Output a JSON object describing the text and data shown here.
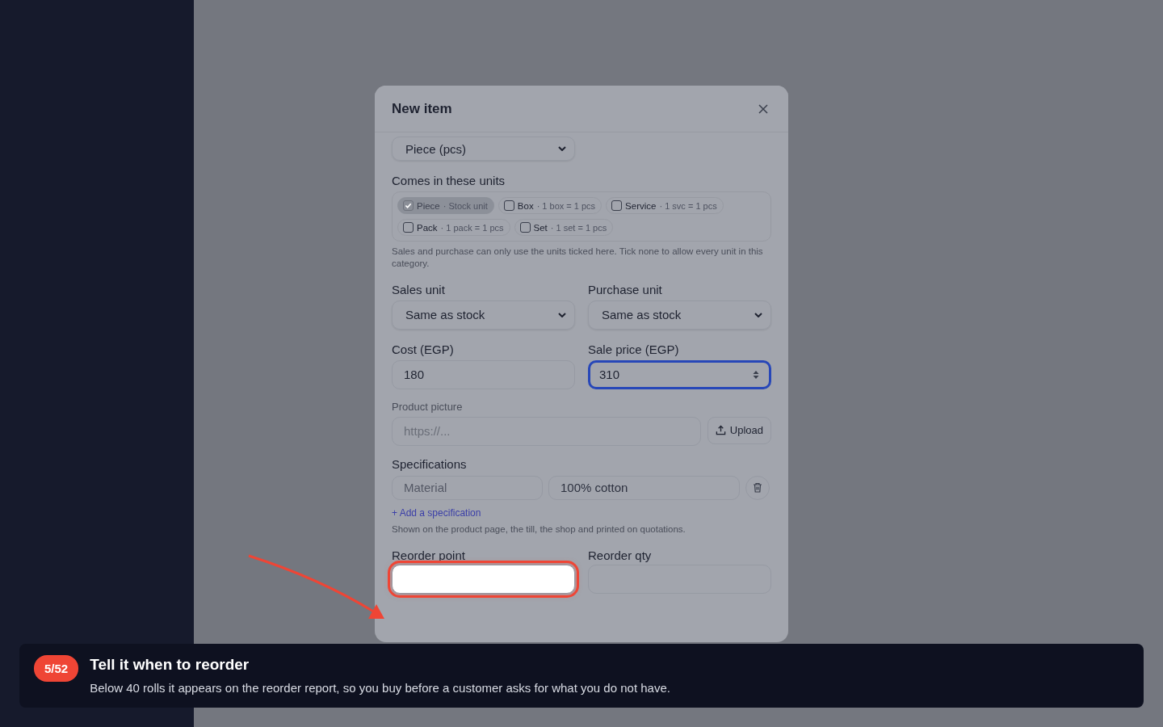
{
  "dialog": {
    "title": "New item",
    "stock_unit": {
      "value": "Piece (pcs)"
    },
    "units_section": {
      "label": "Comes in these units",
      "units": [
        {
          "name": "Piece",
          "note": "· Stock unit",
          "checked": true,
          "disabled": true
        },
        {
          "name": "Box",
          "note": "· 1 box = 1 pcs",
          "checked": false,
          "disabled": false
        },
        {
          "name": "Service",
          "note": "· 1 svc = 1 pcs",
          "checked": false,
          "disabled": false
        },
        {
          "name": "Pack",
          "note": "· 1 pack = 1 pcs",
          "checked": false,
          "disabled": false
        },
        {
          "name": "Set",
          "note": "· 1 set = 1 pcs",
          "checked": false,
          "disabled": false
        }
      ],
      "hint": "Sales and purchase can only use the units ticked here. Tick none to allow every unit in this category."
    },
    "unit_fields": [
      {
        "label": "Sales unit",
        "value": "Same as stock"
      },
      {
        "label": "Purchase unit",
        "value": "Same as stock"
      }
    ],
    "price_fields": [
      {
        "label": "Cost (EGP)",
        "value": "180",
        "focused": false
      },
      {
        "label": "Sale price (EGP)",
        "value": "310",
        "focused": true
      }
    ],
    "picture": {
      "label": "Product picture",
      "placeholder": "https://...",
      "button": "Upload"
    },
    "specifications": {
      "label": "Specifications",
      "rows": [
        {
          "name": "Material",
          "value": "100% cotton"
        }
      ],
      "add_link": "+ Add a specification",
      "hint": "Shown on the product page, the till, the shop and printed on quotations."
    },
    "reorder_fields": [
      {
        "label": "Reorder point",
        "highlighted": true
      },
      {
        "label": "Reorder qty",
        "highlighted": false
      }
    ]
  },
  "tour": {
    "step": "5/52",
    "title": "Tell it when to reorder",
    "text": "Below 40 rolls it appears on the reorder report, so you buy before a customer asks for what you do not have."
  }
}
